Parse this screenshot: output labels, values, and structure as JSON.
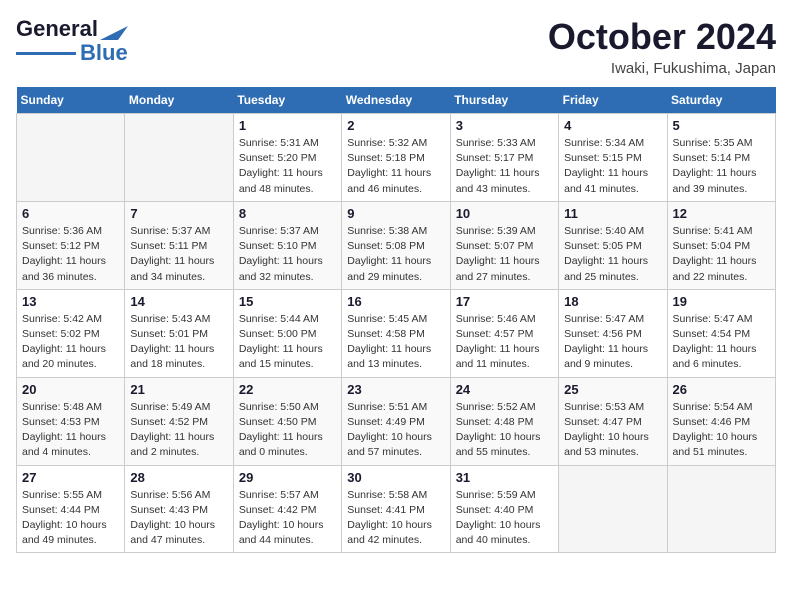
{
  "header": {
    "logo_line1": "General",
    "logo_line2": "Blue",
    "month": "October 2024",
    "location": "Iwaki, Fukushima, Japan"
  },
  "weekdays": [
    "Sunday",
    "Monday",
    "Tuesday",
    "Wednesday",
    "Thursday",
    "Friday",
    "Saturday"
  ],
  "weeks": [
    [
      {
        "day": "",
        "empty": true
      },
      {
        "day": "",
        "empty": true
      },
      {
        "day": "1",
        "sunrise": "5:31 AM",
        "sunset": "5:20 PM",
        "daylight": "11 hours and 48 minutes."
      },
      {
        "day": "2",
        "sunrise": "5:32 AM",
        "sunset": "5:18 PM",
        "daylight": "11 hours and 46 minutes."
      },
      {
        "day": "3",
        "sunrise": "5:33 AM",
        "sunset": "5:17 PM",
        "daylight": "11 hours and 43 minutes."
      },
      {
        "day": "4",
        "sunrise": "5:34 AM",
        "sunset": "5:15 PM",
        "daylight": "11 hours and 41 minutes."
      },
      {
        "day": "5",
        "sunrise": "5:35 AM",
        "sunset": "5:14 PM",
        "daylight": "11 hours and 39 minutes."
      }
    ],
    [
      {
        "day": "6",
        "sunrise": "5:36 AM",
        "sunset": "5:12 PM",
        "daylight": "11 hours and 36 minutes."
      },
      {
        "day": "7",
        "sunrise": "5:37 AM",
        "sunset": "5:11 PM",
        "daylight": "11 hours and 34 minutes."
      },
      {
        "day": "8",
        "sunrise": "5:37 AM",
        "sunset": "5:10 PM",
        "daylight": "11 hours and 32 minutes."
      },
      {
        "day": "9",
        "sunrise": "5:38 AM",
        "sunset": "5:08 PM",
        "daylight": "11 hours and 29 minutes."
      },
      {
        "day": "10",
        "sunrise": "5:39 AM",
        "sunset": "5:07 PM",
        "daylight": "11 hours and 27 minutes."
      },
      {
        "day": "11",
        "sunrise": "5:40 AM",
        "sunset": "5:05 PM",
        "daylight": "11 hours and 25 minutes."
      },
      {
        "day": "12",
        "sunrise": "5:41 AM",
        "sunset": "5:04 PM",
        "daylight": "11 hours and 22 minutes."
      }
    ],
    [
      {
        "day": "13",
        "sunrise": "5:42 AM",
        "sunset": "5:02 PM",
        "daylight": "11 hours and 20 minutes."
      },
      {
        "day": "14",
        "sunrise": "5:43 AM",
        "sunset": "5:01 PM",
        "daylight": "11 hours and 18 minutes."
      },
      {
        "day": "15",
        "sunrise": "5:44 AM",
        "sunset": "5:00 PM",
        "daylight": "11 hours and 15 minutes."
      },
      {
        "day": "16",
        "sunrise": "5:45 AM",
        "sunset": "4:58 PM",
        "daylight": "11 hours and 13 minutes."
      },
      {
        "day": "17",
        "sunrise": "5:46 AM",
        "sunset": "4:57 PM",
        "daylight": "11 hours and 11 minutes."
      },
      {
        "day": "18",
        "sunrise": "5:47 AM",
        "sunset": "4:56 PM",
        "daylight": "11 hours and 9 minutes."
      },
      {
        "day": "19",
        "sunrise": "5:47 AM",
        "sunset": "4:54 PM",
        "daylight": "11 hours and 6 minutes."
      }
    ],
    [
      {
        "day": "20",
        "sunrise": "5:48 AM",
        "sunset": "4:53 PM",
        "daylight": "11 hours and 4 minutes."
      },
      {
        "day": "21",
        "sunrise": "5:49 AM",
        "sunset": "4:52 PM",
        "daylight": "11 hours and 2 minutes."
      },
      {
        "day": "22",
        "sunrise": "5:50 AM",
        "sunset": "4:50 PM",
        "daylight": "11 hours and 0 minutes."
      },
      {
        "day": "23",
        "sunrise": "5:51 AM",
        "sunset": "4:49 PM",
        "daylight": "10 hours and 57 minutes."
      },
      {
        "day": "24",
        "sunrise": "5:52 AM",
        "sunset": "4:48 PM",
        "daylight": "10 hours and 55 minutes."
      },
      {
        "day": "25",
        "sunrise": "5:53 AM",
        "sunset": "4:47 PM",
        "daylight": "10 hours and 53 minutes."
      },
      {
        "day": "26",
        "sunrise": "5:54 AM",
        "sunset": "4:46 PM",
        "daylight": "10 hours and 51 minutes."
      }
    ],
    [
      {
        "day": "27",
        "sunrise": "5:55 AM",
        "sunset": "4:44 PM",
        "daylight": "10 hours and 49 minutes."
      },
      {
        "day": "28",
        "sunrise": "5:56 AM",
        "sunset": "4:43 PM",
        "daylight": "10 hours and 47 minutes."
      },
      {
        "day": "29",
        "sunrise": "5:57 AM",
        "sunset": "4:42 PM",
        "daylight": "10 hours and 44 minutes."
      },
      {
        "day": "30",
        "sunrise": "5:58 AM",
        "sunset": "4:41 PM",
        "daylight": "10 hours and 42 minutes."
      },
      {
        "day": "31",
        "sunrise": "5:59 AM",
        "sunset": "4:40 PM",
        "daylight": "10 hours and 40 minutes."
      },
      {
        "day": "",
        "empty": true
      },
      {
        "day": "",
        "empty": true
      }
    ]
  ]
}
